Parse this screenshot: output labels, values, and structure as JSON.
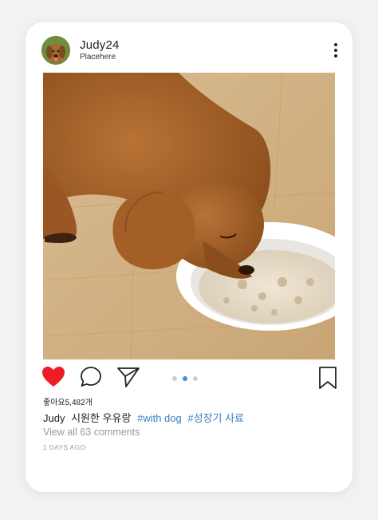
{
  "post": {
    "username": "Judy24",
    "location": "Placehere",
    "likes_text": "좋아요5,482개",
    "caption": {
      "user": "Judy",
      "text": "시원한 우유랑",
      "tags": [
        "#with dog",
        "#성장기 사료"
      ]
    },
    "view_comments": "View all 63 comments",
    "time_ago": "1 DAYS AGO",
    "carousel": {
      "count": 3,
      "active_index": 1
    },
    "liked": true
  },
  "icons": {
    "more": "more-vertical-icon",
    "like": "heart-icon",
    "comment": "comment-icon",
    "share": "send-icon",
    "save": "bookmark-icon"
  },
  "colors": {
    "heart": "#ee1c24",
    "hashtag": "#3a7fc4",
    "active_dot": "#3d8fd8",
    "inactive_dot": "#cfcfcf",
    "muted_text": "#9a9a9a"
  }
}
